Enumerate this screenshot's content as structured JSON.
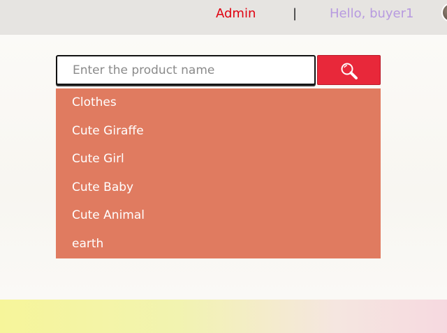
{
  "header": {
    "admin_label": "Admin",
    "divider": "|",
    "greeting": "Hello, buyer1"
  },
  "search": {
    "placeholder": "Enter the product name",
    "value": ""
  },
  "suggestions": [
    "Clothes",
    "Cute Giraffe",
    "Cute Girl",
    "Cute Baby",
    "Cute Animal",
    "earth"
  ],
  "colors": {
    "accent_red": "#e8283a",
    "admin_red": "#e0000f",
    "greeting_purple": "#b79ae0",
    "dropdown_bg": "#e07b60"
  },
  "icons": {
    "search": "magnifier-icon"
  }
}
